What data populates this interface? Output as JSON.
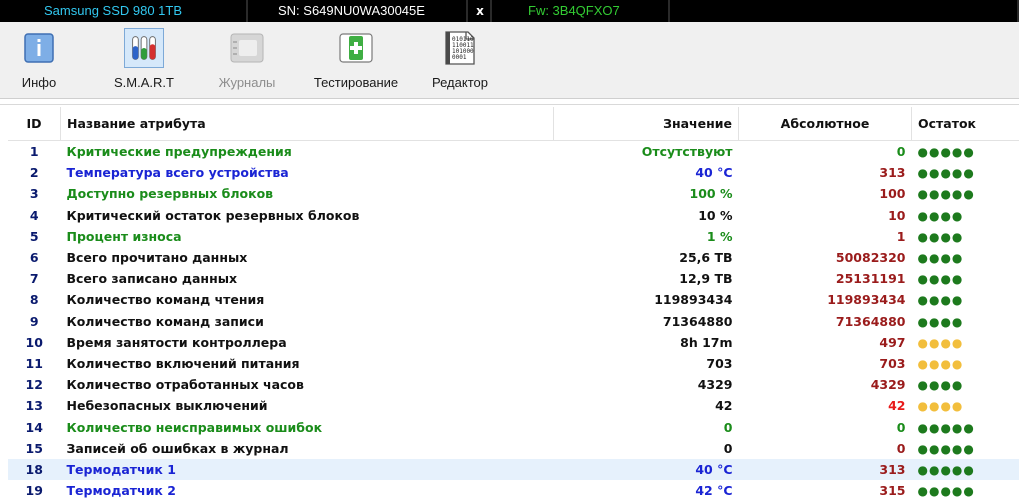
{
  "infobar": {
    "model": "Samsung SSD 980 1TB",
    "serial": "SN: S649NU0WA30045E",
    "close_label": "x",
    "firmware": "Fw: 3B4QFXO7"
  },
  "toolbar": {
    "buttons": [
      {
        "label": "Инфо",
        "icon": "info-icon",
        "disabled": false,
        "active": false
      },
      {
        "label": "S.M.A.R.T",
        "icon": "test-tubes-icon",
        "disabled": false,
        "active": true
      },
      {
        "label": "Журналы",
        "icon": "journal-icon",
        "disabled": true,
        "active": false
      },
      {
        "label": "Тестирование",
        "icon": "first-aid-kit-icon",
        "disabled": false,
        "active": false
      },
      {
        "label": "Редактор",
        "icon": "binary-file-icon",
        "disabled": false,
        "active": false
      }
    ]
  },
  "colors": {
    "green": "#1a8c1a",
    "blue": "#1a24d4",
    "black": "#111111",
    "darkred": "#9a1b1b",
    "red": "#e81a1a",
    "dot_green": "#1d7a1d",
    "dot_yellow": "#f2be3c"
  },
  "table": {
    "headers": {
      "id": "ID",
      "name": "Название атрибута",
      "value": "Значение",
      "absolute": "Абсолютное",
      "rest": "Остаток"
    },
    "rows": [
      {
        "id": "1",
        "name": "Критические предупреждения",
        "value": "Отсутствуют",
        "absolute": "0",
        "name_color": "green",
        "value_color": "green",
        "abs_color": "green",
        "rest_level": 5,
        "rest_color": "dot_green"
      },
      {
        "id": "2",
        "name": "Температура всего устройства",
        "value": "40 °C",
        "absolute": "313",
        "name_color": "blue",
        "value_color": "blue",
        "abs_color": "darkred",
        "rest_level": 5,
        "rest_color": "dot_green"
      },
      {
        "id": "3",
        "name": "Доступно резервных блоков",
        "value": "100 %",
        "absolute": "100",
        "name_color": "green",
        "value_color": "green",
        "abs_color": "darkred",
        "rest_level": 5,
        "rest_color": "dot_green"
      },
      {
        "id": "4",
        "name": "Критический остаток резервных блоков",
        "value": "10 %",
        "absolute": "10",
        "name_color": "black",
        "value_color": "black",
        "abs_color": "darkred",
        "rest_level": 4,
        "rest_color": "dot_green"
      },
      {
        "id": "5",
        "name": "Процент износа",
        "value": "1 %",
        "absolute": "1",
        "name_color": "green",
        "value_color": "green",
        "abs_color": "darkred",
        "rest_level": 4,
        "rest_color": "dot_green"
      },
      {
        "id": "6",
        "name": "Всего прочитано данных",
        "value": "25,6 TB",
        "absolute": "50082320",
        "name_color": "black",
        "value_color": "black",
        "abs_color": "darkred",
        "rest_level": 4,
        "rest_color": "dot_green"
      },
      {
        "id": "7",
        "name": "Всего записано данных",
        "value": "12,9 TB",
        "absolute": "25131191",
        "name_color": "black",
        "value_color": "black",
        "abs_color": "darkred",
        "rest_level": 4,
        "rest_color": "dot_green"
      },
      {
        "id": "8",
        "name": "Количество команд чтения",
        "value": "119893434",
        "absolute": "119893434",
        "name_color": "black",
        "value_color": "black",
        "abs_color": "darkred",
        "rest_level": 4,
        "rest_color": "dot_green"
      },
      {
        "id": "9",
        "name": "Количество команд записи",
        "value": "71364880",
        "absolute": "71364880",
        "name_color": "black",
        "value_color": "black",
        "abs_color": "darkred",
        "rest_level": 4,
        "rest_color": "dot_green"
      },
      {
        "id": "10",
        "name": "Время занятости контроллера",
        "value": "8h 17m",
        "absolute": "497",
        "name_color": "black",
        "value_color": "black",
        "abs_color": "darkred",
        "rest_level": 4,
        "rest_color": "dot_yellow"
      },
      {
        "id": "11",
        "name": "Количество включений питания",
        "value": "703",
        "absolute": "703",
        "name_color": "black",
        "value_color": "black",
        "abs_color": "darkred",
        "rest_level": 4,
        "rest_color": "dot_yellow"
      },
      {
        "id": "12",
        "name": "Количество отработанных часов",
        "value": "4329",
        "absolute": "4329",
        "name_color": "black",
        "value_color": "black",
        "abs_color": "darkred",
        "rest_level": 4,
        "rest_color": "dot_green"
      },
      {
        "id": "13",
        "name": "Небезопасных выключений",
        "value": "42",
        "absolute": "42",
        "name_color": "black",
        "value_color": "black",
        "abs_color": "red",
        "rest_level": 4,
        "rest_color": "dot_yellow"
      },
      {
        "id": "14",
        "name": "Количество неисправимых ошибок",
        "value": "0",
        "absolute": "0",
        "name_color": "green",
        "value_color": "green",
        "abs_color": "green",
        "rest_level": 5,
        "rest_color": "dot_green"
      },
      {
        "id": "15",
        "name": "Записей об ошибках в журнал",
        "value": "0",
        "absolute": "0",
        "name_color": "black",
        "value_color": "black",
        "abs_color": "darkred",
        "rest_level": 5,
        "rest_color": "dot_green"
      },
      {
        "id": "18",
        "name": "Термодатчик 1",
        "value": "40 °C",
        "absolute": "313",
        "name_color": "blue",
        "value_color": "blue",
        "abs_color": "darkred",
        "rest_level": 5,
        "rest_color": "dot_green",
        "selected": true
      },
      {
        "id": "19",
        "name": "Термодатчик 2",
        "value": "42 °C",
        "absolute": "315",
        "name_color": "blue",
        "value_color": "blue",
        "abs_color": "darkred",
        "rest_level": 5,
        "rest_color": "dot_green"
      }
    ]
  }
}
